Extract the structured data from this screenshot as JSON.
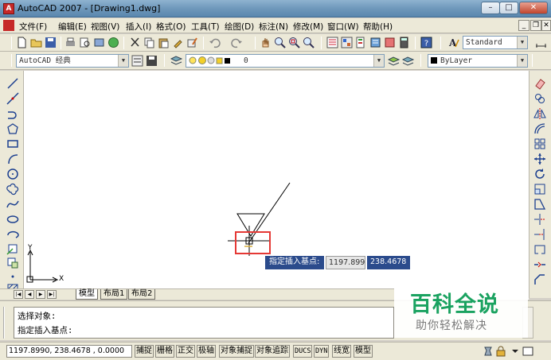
{
  "window": {
    "app_icon": "A",
    "title": "AutoCAD 2007 - [Drawing1.dwg]",
    "minimize": "–",
    "maximize": "□",
    "close": "✕"
  },
  "menu": {
    "items": [
      "文件(F)",
      "编辑(E)",
      "视图(V)",
      "插入(I)",
      "格式(O)",
      "工具(T)",
      "绘图(D)",
      "标注(N)",
      "修改(M)",
      "窗口(W)",
      "帮助(H)"
    ],
    "doc_minimize": "_",
    "doc_restore": "❐",
    "doc_close": "✕"
  },
  "toolbar": {
    "text_style": "Standard",
    "workspace": "AutoCAD 经典",
    "layer_name": "0",
    "color": "ByLayer"
  },
  "layout_tabs": [
    "模型",
    "布局1",
    "布局2"
  ],
  "command_lines": [
    "选择对象:",
    "指定插入基点:"
  ],
  "dynamic_input": {
    "prompt": "指定插入基点:",
    "x_value": "1197.899",
    "y_value": "238.4678"
  },
  "ucs": {
    "x_label": "X",
    "y_label": "Y"
  },
  "status": {
    "coordinates": "1197.8990,  238.4678 ,  0.0000",
    "toggles": [
      "捕捉",
      "栅格",
      "正交",
      "极轴",
      "对象捕捉",
      "对象追踪",
      "DUCS",
      "DYN",
      "线宽",
      "模型"
    ]
  },
  "watermark": {
    "title": "百科全说",
    "subtitle": "助你轻松解决"
  },
  "colors": {
    "accent_red": "#e53935",
    "dyn_blue": "#2b4b8c",
    "watermark_green": "#1aa260"
  },
  "icons": {
    "toolbar": [
      "new-icon",
      "open-icon",
      "save-icon",
      "print-icon",
      "preview-icon",
      "publish-icon",
      "3d-dwf-icon",
      "cut-icon",
      "copy-icon",
      "paste-icon",
      "match-properties-icon",
      "block-editor-icon",
      "undo-icon",
      "redo-icon",
      "pan-icon",
      "zoom-realtime-icon",
      "zoom-window-icon",
      "zoom-previous-icon",
      "properties-icon",
      "design-center-icon",
      "tool-palettes-icon",
      "sheet-set-icon",
      "markup-icon",
      "quickcalc-icon",
      "help-icon"
    ],
    "draw": [
      "line-icon",
      "construction-line-icon",
      "polyline-icon",
      "polygon-icon",
      "rectangle-icon",
      "arc-icon",
      "circle-icon",
      "revision-cloud-icon",
      "spline-icon",
      "ellipse-icon",
      "ellipse-arc-icon",
      "insert-block-icon",
      "make-block-icon",
      "point-icon",
      "hatch-icon"
    ],
    "modify": [
      "erase-icon",
      "copy-object-icon",
      "mirror-icon",
      "offset-icon",
      "array-icon",
      "move-icon",
      "rotate-icon",
      "scale-icon",
      "stretch-icon",
      "trim-icon",
      "extend-icon",
      "break-icon",
      "join-icon",
      "chamfer-icon"
    ]
  }
}
